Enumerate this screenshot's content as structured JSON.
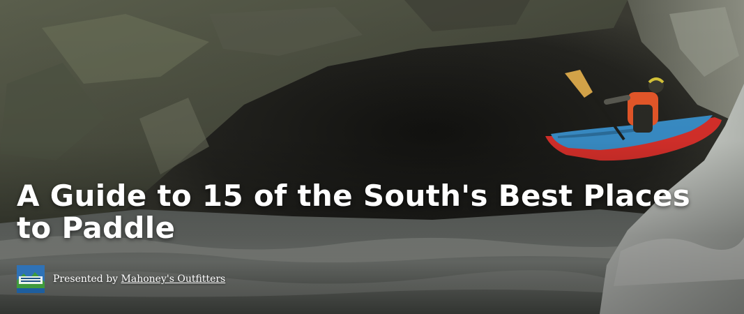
{
  "article": {
    "title": "A Guide to 15 of the South's Best Places to Paddle"
  },
  "sponsor": {
    "prefix": "Presented by",
    "name": "Mahoney's Outfitters",
    "logo_icon": "mahoneys-outfitters-logo",
    "logo_text": "Mahoney's Outfitters"
  },
  "colors": {
    "title_text": "#ffffff",
    "kayak_hull": "#d9302b",
    "kayak_deck": "#3a8fc9",
    "paddler_jacket": "#e8582a",
    "water": "#c9ccc6",
    "rock": "#4a4a40"
  }
}
